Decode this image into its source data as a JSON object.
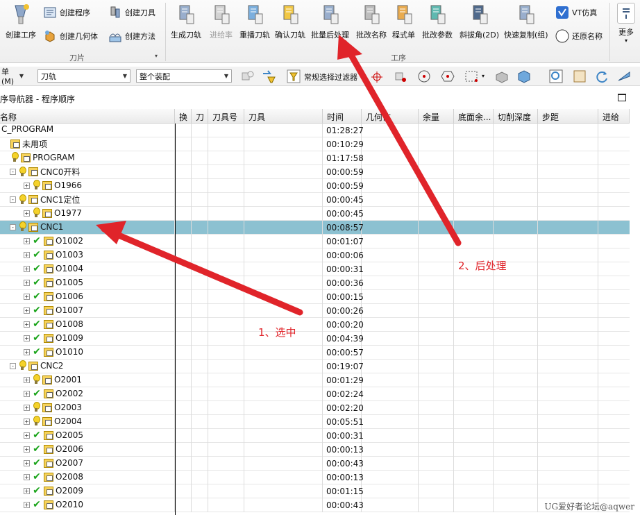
{
  "ribbon": {
    "blade_group": {
      "create_operation": "创建工序",
      "create_program": "创建程序",
      "create_tool": "创建刀具",
      "create_geometry": "创建几何体",
      "create_method": "创建方法",
      "label": "刀片"
    },
    "operation_group": {
      "buttons": [
        {
          "label": "生成刀轨",
          "icon": "generate-toolpath-icon"
        },
        {
          "label": "进给率",
          "icon": "feedrate-icon",
          "disabled": true
        },
        {
          "label": "重播刀轨",
          "icon": "replay-toolpath-icon"
        },
        {
          "label": "确认刀轨",
          "icon": "verify-toolpath-icon"
        },
        {
          "label": "批量后处理",
          "icon": "batch-postprocess-icon"
        },
        {
          "label": "批改名称",
          "icon": "batch-rename-icon"
        },
        {
          "label": "程式单",
          "icon": "program-sheet-icon"
        },
        {
          "label": "批改参数",
          "icon": "batch-params-icon"
        },
        {
          "label": "斜拔角(2D)",
          "icon": "draft-angle-icon"
        },
        {
          "label": "快速复制(组)",
          "icon": "quick-copy-icon"
        }
      ],
      "vt_sim": "VT仿真",
      "restore_name": "还原名称",
      "label": "工序"
    },
    "more": "更多"
  },
  "toolbar": {
    "menu_label": "单(M)",
    "filter_type": "刀轨",
    "scope": "整个装配",
    "selection_filter": "常规选择过滤器"
  },
  "navigator": {
    "title": "序导航器 - 程序顺序",
    "columns": [
      "名称",
      "换",
      "刀",
      "刀具号",
      "刀具",
      "时间",
      "几何体",
      "余量",
      "底面余...",
      "切削深度",
      "步距",
      "进给"
    ],
    "rows": [
      {
        "name": "C_PROGRAM",
        "time": "01:28:27",
        "level": 0,
        "status": "none",
        "expand": false
      },
      {
        "name": "未用项",
        "time": "00:10:29",
        "level": 1,
        "status": "none",
        "expand": false
      },
      {
        "name": "PROGRAM",
        "time": "01:17:58",
        "level": 1,
        "status": "bulb",
        "expand": false
      },
      {
        "name": "CNC0开料",
        "time": "00:00:59",
        "level": 2,
        "status": "bulb",
        "expand": "-"
      },
      {
        "name": "O1966",
        "time": "00:00:59",
        "level": 3,
        "status": "bulb",
        "expand": "+"
      },
      {
        "name": "CNC1定位",
        "time": "00:00:45",
        "level": 2,
        "status": "bulb",
        "expand": "-"
      },
      {
        "name": "O1977",
        "time": "00:00:45",
        "level": 3,
        "status": "bulb",
        "expand": "+"
      },
      {
        "name": "CNC1",
        "time": "00:08:57",
        "level": 2,
        "status": "bulb",
        "expand": "-",
        "selected": true
      },
      {
        "name": "O1002",
        "time": "00:01:07",
        "level": 3,
        "status": "check",
        "expand": "+"
      },
      {
        "name": "O1003",
        "time": "00:00:06",
        "level": 3,
        "status": "check",
        "expand": "+"
      },
      {
        "name": "O1004",
        "time": "00:00:31",
        "level": 3,
        "status": "check",
        "expand": "+"
      },
      {
        "name": "O1005",
        "time": "00:00:36",
        "level": 3,
        "status": "check",
        "expand": "+"
      },
      {
        "name": "O1006",
        "time": "00:00:15",
        "level": 3,
        "status": "check",
        "expand": "+"
      },
      {
        "name": "O1007",
        "time": "00:00:26",
        "level": 3,
        "status": "check",
        "expand": "+"
      },
      {
        "name": "O1008",
        "time": "00:00:20",
        "level": 3,
        "status": "check",
        "expand": "+"
      },
      {
        "name": "O1009",
        "time": "00:04:39",
        "level": 3,
        "status": "check",
        "expand": "+"
      },
      {
        "name": "O1010",
        "time": "00:00:57",
        "level": 3,
        "status": "check",
        "expand": "+"
      },
      {
        "name": "CNC2",
        "time": "00:19:07",
        "level": 2,
        "status": "bulb",
        "expand": "-"
      },
      {
        "name": "O2001",
        "time": "00:01:29",
        "level": 3,
        "status": "bulb",
        "expand": "+"
      },
      {
        "name": "O2002",
        "time": "00:02:24",
        "level": 3,
        "status": "check",
        "expand": "+"
      },
      {
        "name": "O2003",
        "time": "00:02:20",
        "level": 3,
        "status": "bulb",
        "expand": "+"
      },
      {
        "name": "O2004",
        "time": "00:05:51",
        "level": 3,
        "status": "bulb",
        "expand": "+"
      },
      {
        "name": "O2005",
        "time": "00:00:31",
        "level": 3,
        "status": "check",
        "expand": "+"
      },
      {
        "name": "O2006",
        "time": "00:00:13",
        "level": 3,
        "status": "check",
        "expand": "+"
      },
      {
        "name": "O2007",
        "time": "00:00:43",
        "level": 3,
        "status": "check",
        "expand": "+"
      },
      {
        "name": "O2008",
        "time": "00:00:13",
        "level": 3,
        "status": "check",
        "expand": "+"
      },
      {
        "name": "O2009",
        "time": "00:01:15",
        "level": 3,
        "status": "check",
        "expand": "+"
      },
      {
        "name": "O2010",
        "time": "00:00:43",
        "level": 3,
        "status": "check",
        "expand": "+"
      }
    ]
  },
  "annotations": {
    "step1": "1、选中",
    "step2": "2、后处理",
    "color": "#e0242a"
  },
  "watermark": "UG爱好者论坛@aqwer",
  "colors": {
    "selected_row": "#8cc1d1",
    "check": "#1aa41a",
    "bulb": "#f5d22a"
  }
}
